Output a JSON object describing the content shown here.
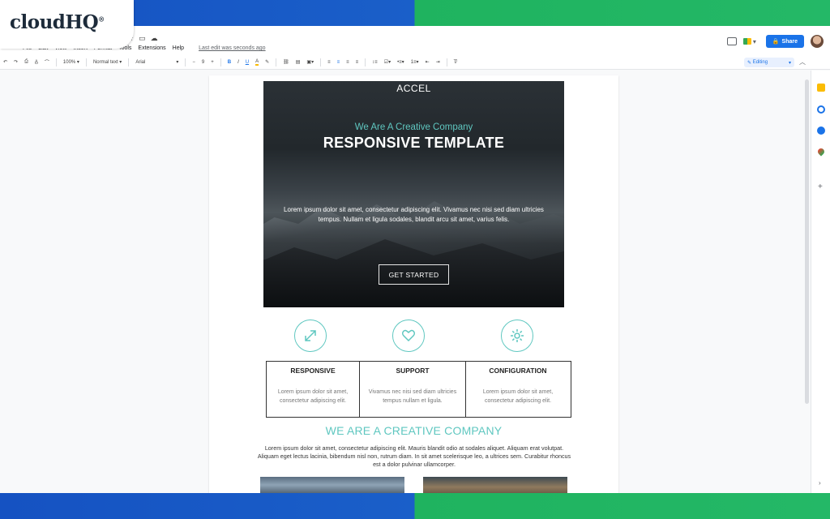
{
  "brand": {
    "logo_text": "cloudHQ",
    "logo_mark": "®"
  },
  "docs": {
    "menu": [
      "File",
      "Edit",
      "View",
      "Insert",
      "Format",
      "Tools",
      "Extensions",
      "Help"
    ],
    "last_edit": "Last edit was seconds ago",
    "share_label": "Share",
    "mode_label": "Editing",
    "toolbar": {
      "zoom": "100%",
      "style": "Normal text",
      "font": "Arial",
      "size": "9"
    }
  },
  "email": {
    "brand": "ACCEL",
    "subtitle": "We Are A Creative Company",
    "title": "RESPONSIVE TEMPLATE",
    "body": "Lorem ipsum dolor sit amet, consectetur adipiscing elit. Vivamus nec nisi sed diam ultricies tempus. Nullam et ligula sodales, blandit arcu sit amet, varius felis.",
    "cta": "GET STARTED",
    "features": [
      {
        "icon": "expand-arrows-icon",
        "title": "RESPONSIVE",
        "text": "Lorem ipsum dolor sit amet, consectetur adipiscing elit."
      },
      {
        "icon": "heart-icon",
        "title": "SUPPORT",
        "text": "Vivamus nec nisi sed diam ultricies tempus nullam et ligula."
      },
      {
        "icon": "gear-icon",
        "title": "CONFIGURATION",
        "text": "Lorem ipsum dolor sit amet, consectetur adipiscing elit."
      }
    ],
    "section_title": "WE ARE A CREATIVE COMPANY",
    "section_text": "Lorem ipsum dolor sit amet, consectetur adipiscing elit. Mauris blandit odio at sodales aliquet. Aliquam erat volutpat. Aliquam eget lectus lacinia, bibendum nisl non, rutrum diam. In sit amet scelerisque leo, a ultrices sem. Curabitur rhoncus est a dolor pulvinar ullamcorper."
  },
  "colors": {
    "accent": "#5fc7c0",
    "share_blue": "#1a73e8",
    "bar_blue": "#1a5fc9",
    "bar_green": "#1fb35f"
  }
}
